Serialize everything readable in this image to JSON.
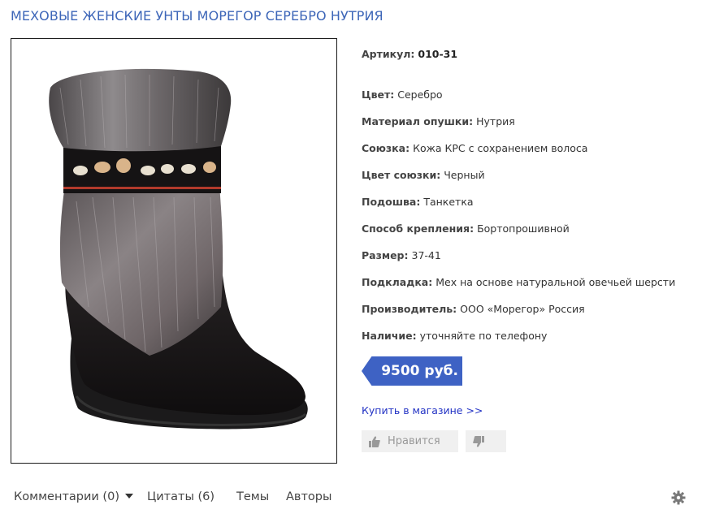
{
  "product": {
    "title": "МЕХОВЫЕ ЖЕНСКИЕ УНТЫ МОРЕГОР СЕРЕБРО НУТРИЯ",
    "article_label": "Артикул:",
    "article_value": "010-31",
    "specs": [
      {
        "label": "Цвет:",
        "value": "Серебро"
      },
      {
        "label": "Материал опушки:",
        "value": "Нутрия"
      },
      {
        "label": "Союзка:",
        "value": "Кожа КРС с сохранением волоса"
      },
      {
        "label": "Цвет союзки:",
        "value": "Черный"
      },
      {
        "label": "Подошва:",
        "value": "Танкетка"
      },
      {
        "label": "Способ крепления:",
        "value": "Бортопрошивной"
      },
      {
        "label": "Размер:",
        "value": "37-41"
      },
      {
        "label": "Подкладка:",
        "value": "Мех на основе натуральной овечьей шерсти"
      },
      {
        "label": "Производитель:",
        "value": "ООО «Морегор» Россия"
      },
      {
        "label": "Наличие:",
        "value": "уточняйте по телефону"
      }
    ],
    "price": "9500 руб.",
    "buy_link": "Купить в магазине >>",
    "like_label": "Нравится"
  },
  "tabs": {
    "comments": "Комментарии (0)",
    "quotes": "Цитаты (6)",
    "topics": "Темы",
    "authors": "Авторы"
  },
  "colors": {
    "title": "#3d66b8",
    "price_badge": "#3e62c4",
    "link": "#2232c4"
  },
  "icons": [
    "thumbs-up-icon",
    "thumbs-down-icon",
    "caret-down-icon",
    "gear-icon"
  ]
}
